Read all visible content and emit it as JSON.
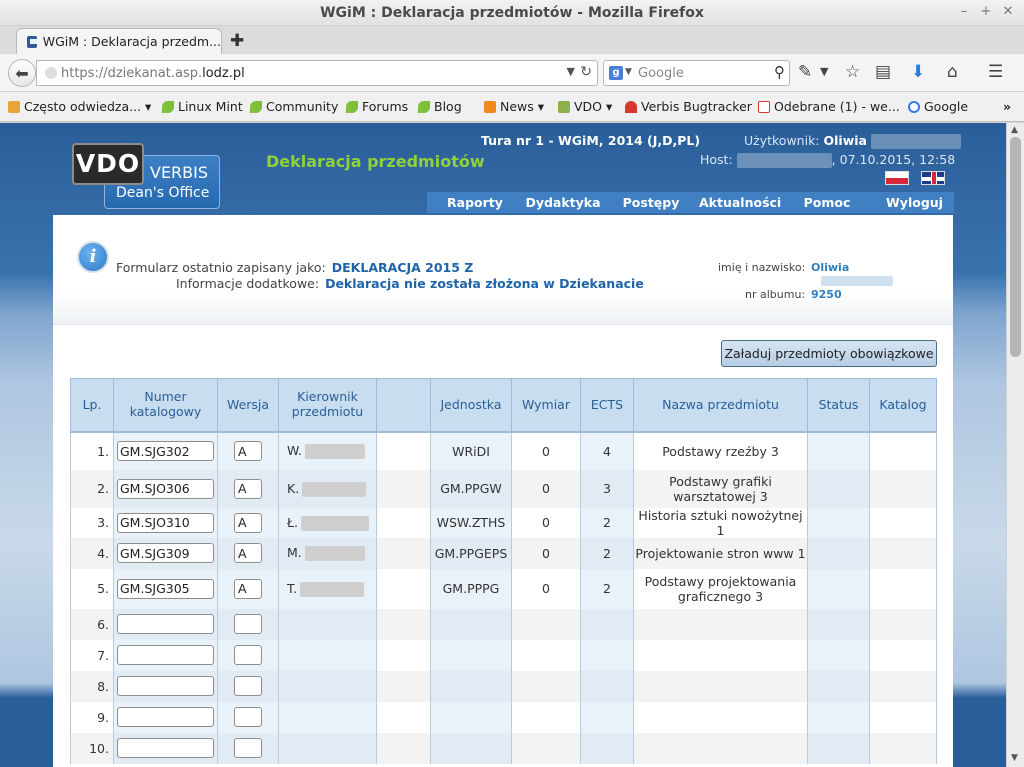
{
  "window": {
    "title": "WGiM : Deklaracja przedmiotów - Mozilla Firefox"
  },
  "browser": {
    "tab_label": "WGiM : Deklaracja przedm...",
    "url_prefix": "https://dziekanat.asp.",
    "url_domain": "lodz.pl",
    "search_placeholder": "Google",
    "bookmarks": [
      {
        "label": "Często odwiedza... ▾",
        "icon": "folder-icon"
      },
      {
        "label": "Linux Mint",
        "icon": "mint-leaf-icon"
      },
      {
        "label": "Community",
        "icon": "mint-leaf-icon"
      },
      {
        "label": "Forums",
        "icon": "mint-leaf-icon"
      },
      {
        "label": "Blog",
        "icon": "mint-leaf-icon"
      },
      {
        "label": "News ▾",
        "icon": "rss-icon"
      },
      {
        "label": "VDO ▾",
        "icon": "folder-icon"
      },
      {
        "label": "Verbis Bugtracker",
        "icon": "verbis-icon"
      },
      {
        "label": "Odebrane (1) - we...",
        "icon": "gmail-icon"
      },
      {
        "label": "Google",
        "icon": "google-icon"
      }
    ]
  },
  "header": {
    "logo_vdo": "VDO",
    "logo_verbis": "VERBIS",
    "logo_deans": "Dean's Office",
    "app_title": "Deklaracja przedmiotów",
    "tura": "Tura nr 1 - WGiM, 2014 (J,D,PL)",
    "user_label": "Użytkownik:",
    "user_name": "Oliwia",
    "host_label": "Host:",
    "host_date": ", 07.10.2015, 12:58",
    "menu": [
      "Raporty",
      "Dydaktyka",
      "Postępy",
      "Aktualności",
      "Pomoc",
      "Wyloguj"
    ]
  },
  "info": {
    "saved_label": "Formularz ostatnio zapisany jako:",
    "saved_value": "DEKLARACJA 2015 Z",
    "extra_label": "Informacje dodatkowe:",
    "extra_value": "Deklaracja nie została złożona w Dziekanacie",
    "name_label": "imię i nazwisko:",
    "name_value": "Oliwia",
    "album_label": "nr albumu:",
    "album_value": "9250"
  },
  "load_button": "Załaduj przedmioty obowiązkowe",
  "table": {
    "headers": [
      "Lp.",
      "Numer katalogowy",
      "Wersja",
      "Kierownik przedmiotu",
      "",
      "Jednostka",
      "Wymiar",
      "ECTS",
      "Nazwa przedmiotu",
      "Status",
      "Katalog"
    ],
    "rows": [
      {
        "lp": "1.",
        "numer": "GM.SJG302",
        "wersja": "A",
        "kierownik": "W.",
        "jednostka": "WRiDI",
        "wymiar": "0",
        "ects": "4",
        "nazwa": "Podstawy rzeźby 3"
      },
      {
        "lp": "2.",
        "numer": "GM.SJO306",
        "wersja": "A",
        "kierownik": "K.",
        "jednostka": "GM.PPGW",
        "wymiar": "0",
        "ects": "3",
        "nazwa": "Podstawy grafiki warsztatowej 3"
      },
      {
        "lp": "3.",
        "numer": "GM.SJO310",
        "wersja": "A",
        "kierownik": "Ł.",
        "jednostka": "WSW.ZTHS",
        "wymiar": "0",
        "ects": "2",
        "nazwa": "Historia sztuki nowożytnej 1"
      },
      {
        "lp": "4.",
        "numer": "GM.SJG309",
        "wersja": "A",
        "kierownik": "M.",
        "jednostka": "GM.PPGEPS",
        "wymiar": "0",
        "ects": "2",
        "nazwa": "Projektowanie stron www 1"
      },
      {
        "lp": "5.",
        "numer": "GM.SJG305",
        "wersja": "A",
        "kierownik": "T.",
        "jednostka": "GM.PPPG",
        "wymiar": "0",
        "ects": "2",
        "nazwa": "Podstawy projektowania graficznego 3"
      },
      {
        "lp": "6.",
        "numer": "",
        "wersja": "",
        "kierownik": "",
        "jednostka": "",
        "wymiar": "",
        "ects": "",
        "nazwa": ""
      },
      {
        "lp": "7.",
        "numer": "",
        "wersja": "",
        "kierownik": "",
        "jednostka": "",
        "wymiar": "",
        "ects": "",
        "nazwa": ""
      },
      {
        "lp": "8.",
        "numer": "",
        "wersja": "",
        "kierownik": "",
        "jednostka": "",
        "wymiar": "",
        "ects": "",
        "nazwa": ""
      },
      {
        "lp": "9.",
        "numer": "",
        "wersja": "",
        "kierownik": "",
        "jednostka": "",
        "wymiar": "",
        "ects": "",
        "nazwa": ""
      },
      {
        "lp": "10.",
        "numer": "",
        "wersja": "",
        "kierownik": "",
        "jednostka": "",
        "wymiar": "",
        "ects": "",
        "nazwa": ""
      }
    ]
  }
}
